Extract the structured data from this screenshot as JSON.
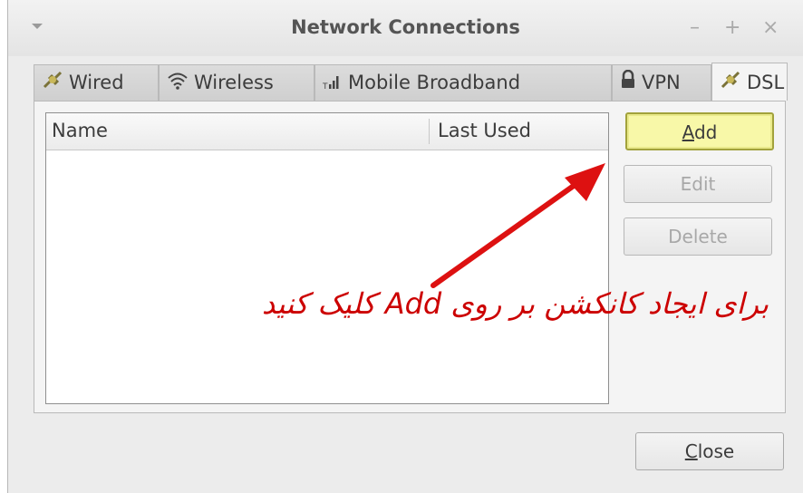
{
  "window": {
    "title": "Network Connections",
    "controls": {
      "minimize": "–",
      "maximize": "+",
      "close": "×"
    }
  },
  "tabs": [
    {
      "label": "Wired",
      "icon": "plug-icon",
      "active": false
    },
    {
      "label": "Wireless",
      "icon": "wifi-icon",
      "active": false
    },
    {
      "label": "Mobile Broadband",
      "icon": "signal-bars-icon",
      "active": false
    },
    {
      "label": "VPN",
      "icon": "lock-icon",
      "active": false
    },
    {
      "label": "DSL",
      "icon": "plug-icon",
      "active": true
    }
  ],
  "connection_list": {
    "columns": [
      "Name",
      "Last Used"
    ],
    "rows": []
  },
  "buttons": {
    "add": "Add",
    "edit": "Edit",
    "delete": "Delete",
    "close": "Close"
  },
  "annotation": {
    "text": "برای ایجاد کانکشن بر روی Add کلیک کنید",
    "color": "#cc0000"
  },
  "colors": {
    "highlight_button": "#f8f8a8",
    "arrow": "#dd1111"
  }
}
